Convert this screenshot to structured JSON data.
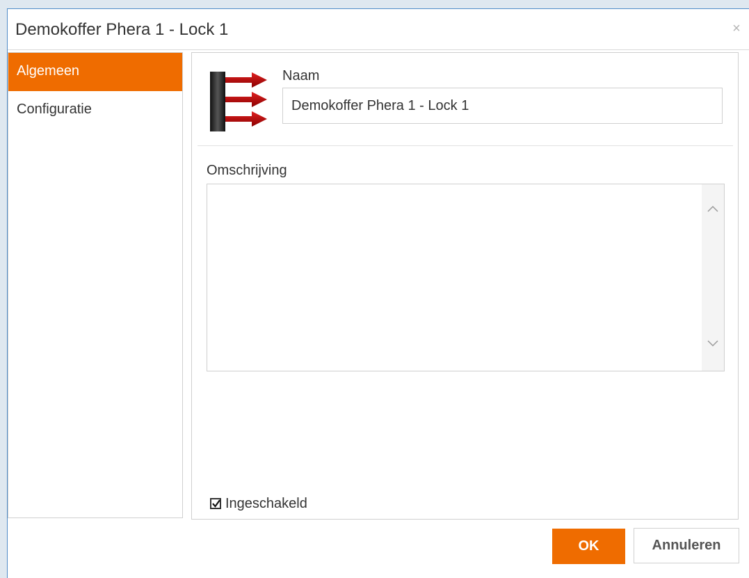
{
  "dialog": {
    "title": "Demokoffer Phera 1 - Lock 1",
    "close_glyph": "×"
  },
  "nav": {
    "items": [
      {
        "label": "Algemeen",
        "active": true
      },
      {
        "label": "Configuratie",
        "active": false
      }
    ]
  },
  "form": {
    "icon": "lock-device-icon",
    "naam_label": "Naam",
    "naam_value": "Demokoffer Phera 1 - Lock 1",
    "omschrijving_label": "Omschrijving",
    "omschrijving_value": "",
    "ingeschakeld_label": "Ingeschakeld",
    "ingeschakeld_checked": true
  },
  "buttons": {
    "ok_label": "OK",
    "cancel_label": "Annuleren"
  },
  "colors": {
    "accent": "#ef6c00",
    "dialog_border": "#4f8bc7"
  }
}
